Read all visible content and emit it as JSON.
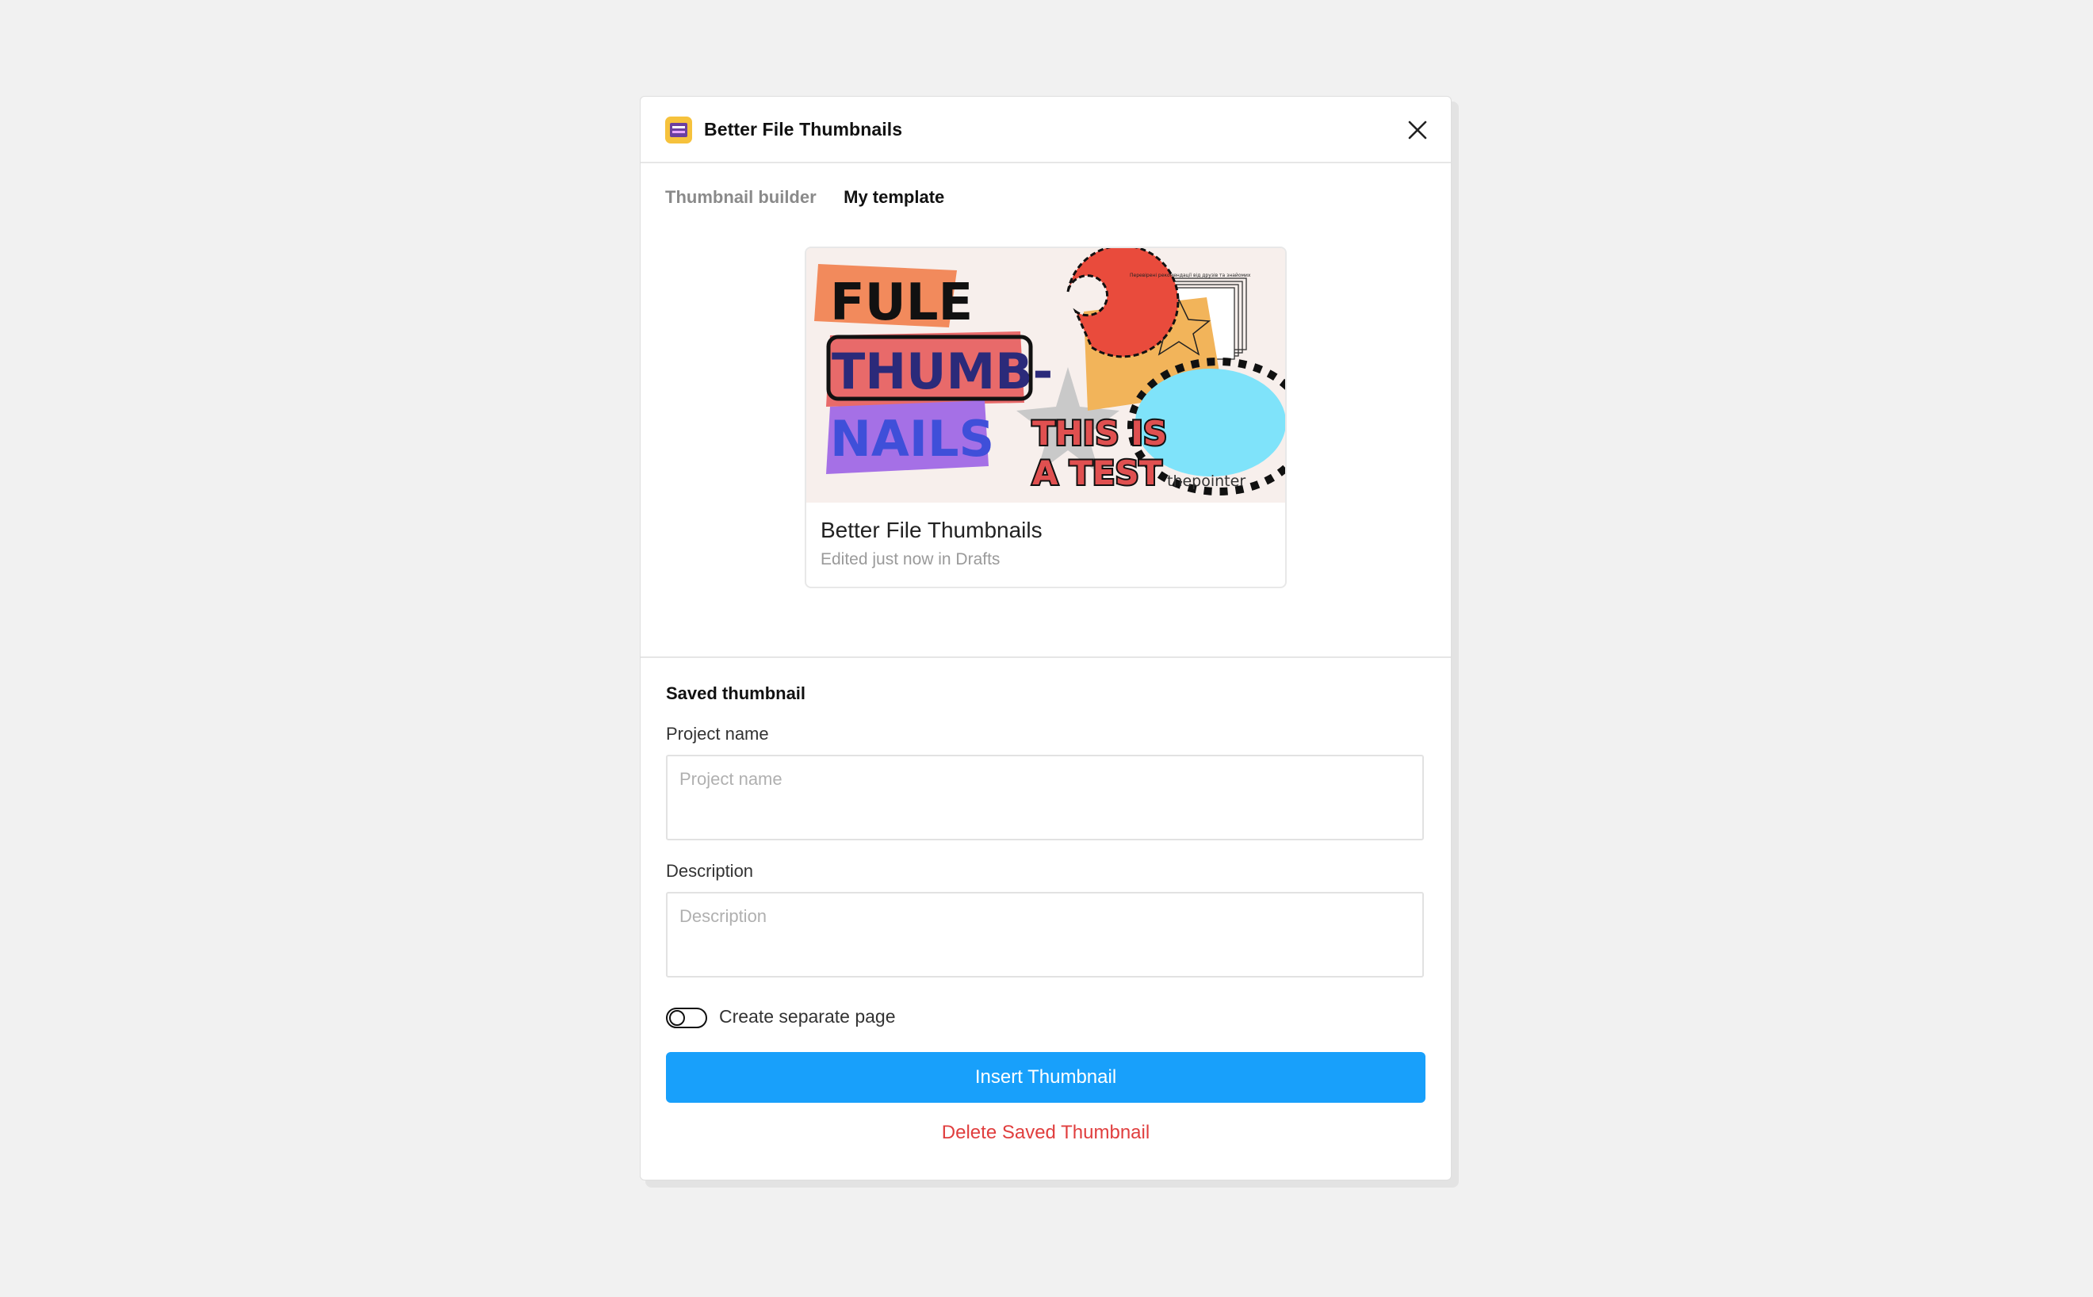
{
  "plugin": {
    "title": "Better File Thumbnails",
    "icon": "plugin-app-icon",
    "close_icon": "close-icon"
  },
  "tabs": [
    {
      "label": "Thumbnail builder",
      "active": false
    },
    {
      "label": "My template",
      "active": true
    }
  ],
  "preview": {
    "card_title": "Better File Thumbnails",
    "card_subtitle": "Edited just now in Drafts",
    "art": {
      "line1": "FULE",
      "line2": "THUMB-",
      "line3": "NAILS",
      "sticker1": "THIS IS",
      "sticker2": "A TEST",
      "small_note": "Перевірені рекомендації від друзів та знайомих",
      "watermark": "thepointer"
    }
  },
  "saved": {
    "section_title": "Saved thumbnail",
    "project_label": "Project name",
    "project_placeholder": "Project name",
    "project_value": "",
    "description_label": "Description",
    "description_placeholder": "Description",
    "description_value": "",
    "toggle_label": "Create separate page",
    "toggle_on": false
  },
  "actions": {
    "insert_label": "Insert Thumbnail",
    "delete_label": "Delete Saved Thumbnail"
  },
  "colors": {
    "primary": "#18a0fb",
    "danger": "#e03e3e"
  }
}
